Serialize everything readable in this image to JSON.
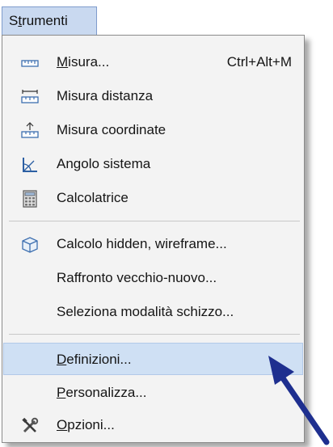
{
  "menu": {
    "title_before": "S",
    "title_accel": "t",
    "title_after": "rumenti"
  },
  "items": [
    {
      "icon": "ruler-icon",
      "before": "",
      "accel": "M",
      "after": "isura...",
      "shortcut": "Ctrl+Alt+M"
    },
    {
      "icon": "ruler-distance-icon",
      "before": "Misura distanza",
      "accel": "",
      "after": "",
      "shortcut": ""
    },
    {
      "icon": "ruler-coordinate-icon",
      "before": "Misura coordinate",
      "accel": "",
      "after": "",
      "shortcut": ""
    },
    {
      "icon": "angle-system-icon",
      "before": "Angolo sistema",
      "accel": "",
      "after": "",
      "shortcut": ""
    },
    {
      "icon": "calculator-icon",
      "before": "Calcolatrice",
      "accel": "",
      "after": "",
      "shortcut": ""
    },
    {
      "icon": "cube-icon",
      "before": "Calcolo hidden, wireframe...",
      "accel": "",
      "after": "",
      "shortcut": ""
    },
    {
      "icon": "",
      "before": "Raffronto vecchio-nuovo...",
      "accel": "",
      "after": "",
      "shortcut": ""
    },
    {
      "icon": "",
      "before": "Seleziona modalità schizzo...",
      "accel": "",
      "after": "",
      "shortcut": ""
    },
    {
      "icon": "",
      "before": "",
      "accel": "D",
      "after": "efinizioni...",
      "shortcut": "",
      "highlighted": true
    },
    {
      "icon": "",
      "before": "",
      "accel": "P",
      "after": "ersonalizza...",
      "shortcut": ""
    },
    {
      "icon": "tools-icon",
      "before": "",
      "accel": "O",
      "after": "pzioni...",
      "shortcut": ""
    }
  ],
  "colors": {
    "highlight": "#cfe0f4",
    "menu_bg": "#f3f3f3",
    "arrow": "#1e2f8f"
  }
}
